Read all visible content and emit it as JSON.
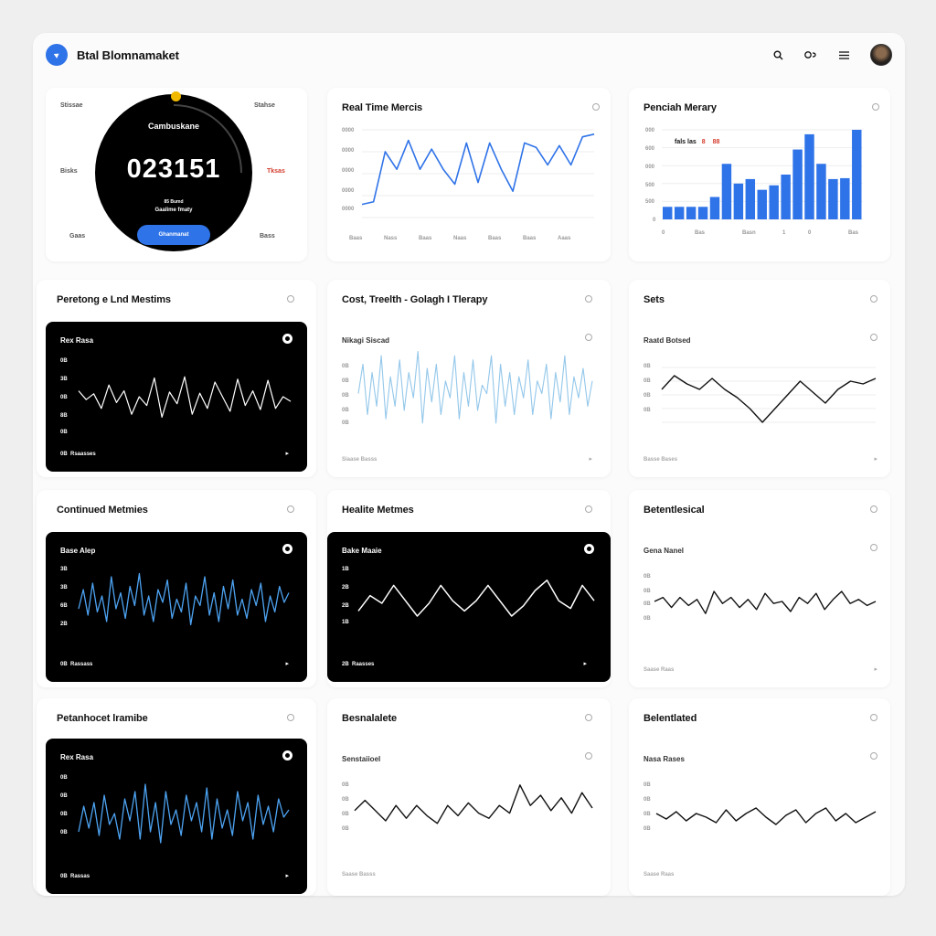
{
  "app": {
    "title": "Btal Blomnamaket"
  },
  "header": {
    "search_icon": "search-icon",
    "settings_icon": "settings-icon",
    "menu_icon": "menu-icon",
    "avatar_icon": "avatar"
  },
  "gauge": {
    "title": "Cambuskane",
    "value": "023151",
    "note1": "85 Bumd",
    "note2": "Gaalime fmaty",
    "button": "Ghanmanat",
    "labels": {
      "top_left": "Stissae",
      "top_right": "Stahse",
      "mid_left": "Bisks",
      "mid_right": "Tksas",
      "bottom_left": "Gaas",
      "bottom_right": "Bass"
    },
    "colors": {
      "ring": "#000000",
      "accent": "#f1b900",
      "button": "#2f73e8",
      "warning": "#d43b2c"
    }
  },
  "cards": {
    "realtime": {
      "title": "Real Time Mercis",
      "ylabels": [
        "0000",
        "0000",
        "0000",
        "0000",
        "0000"
      ],
      "xlabels": [
        "Baas",
        "Nass",
        "Baas",
        "Naas",
        "Baas",
        "Baas",
        "Aaas"
      ]
    },
    "penciah": {
      "title": "Penciah Merary",
      "legend": "fals las",
      "legend_red": "8",
      "legend_red2": "88",
      "ylabels": [
        "000",
        "600",
        "000",
        "500",
        "500",
        "0"
      ],
      "xlabels": [
        "0",
        "Bas",
        "Basn",
        "1",
        "0",
        "Bas"
      ]
    },
    "pertong": {
      "title": "Peretong e Lnd Mestims",
      "panel_label": "Rex Rasa",
      "ylabels": [
        "0B",
        "3B",
        "0B",
        "8B",
        "0B"
      ],
      "foot": "Rsaasses",
      "foot_num": "0B"
    },
    "cost": {
      "title": "Cost, Treelth - Golagh I Tlerapy",
      "panel_label": "Nikagi Siscad",
      "ylabels": [
        "0B",
        "0B",
        "0B",
        "0B",
        "0B"
      ],
      "foot": "Siaase Basss"
    },
    "sets": {
      "title": "Sets",
      "panel_label": "Raatd Botsed",
      "ylabels": [
        "0B",
        "0B",
        "0B",
        "0B"
      ],
      "foot": "Basse Bases"
    },
    "continued": {
      "title": "Continued Metmies",
      "panel_label": "Base Alep",
      "ylabels": [
        "3B",
        "3B",
        "6B",
        "2B"
      ],
      "foot": "Rassass",
      "foot_num": "0B"
    },
    "healite": {
      "title": "Healite Metmes",
      "panel_label": "Bake Maaie",
      "ylabels": [
        "1B",
        "2B",
        "2B",
        "1B"
      ],
      "foot": "Raasses",
      "foot_num": "2B"
    },
    "betentle": {
      "title": "Betentlesical",
      "panel_label": "Gena Nanel",
      "ylabels": [
        "0B",
        "0B",
        "0B",
        "0B"
      ],
      "foot": "Saase Raas"
    },
    "petanoncel": {
      "title": "Petanhocet lramibe",
      "panel_label": "Rex Rasa",
      "ylabels": [
        "0B",
        "0B",
        "0B",
        "0B"
      ],
      "foot": "Rassas",
      "foot_num": "0B"
    },
    "besninte": {
      "title": "Besnalalete",
      "panel_label": "Senstaiioel",
      "ylabels": [
        "0B",
        "0B",
        "0B",
        "0B"
      ],
      "foot": "Saase Basss"
    },
    "beleni": {
      "title": "Belentlated",
      "panel_label": "Nasa Rases",
      "ylabels": [
        "0B",
        "0B",
        "0B",
        "0B"
      ],
      "foot": "Saase Raas"
    }
  },
  "chart_data": [
    {
      "type": "line",
      "title": "Real Time Mercis",
      "series": [
        {
          "values": [
            0.15,
            0.18,
            0.75,
            0.55,
            0.88,
            0.55,
            0.78,
            0.55,
            0.38,
            0.85,
            0.4,
            0.85,
            0.55,
            0.3,
            0.85,
            0.8,
            0.6,
            0.82,
            0.6,
            0.92,
            0.95
          ]
        }
      ],
      "grid": true
    },
    {
      "type": "bar",
      "title": "Penciah Merary",
      "values": [
        0.14,
        0.14,
        0.14,
        0.14,
        0.25,
        0.62,
        0.4,
        0.45,
        0.33,
        0.38,
        0.5,
        0.78,
        0.95,
        0.62,
        0.45,
        0.46,
        1.0
      ],
      "grid": true
    },
    {
      "type": "line",
      "title": "Peretong e Lnd Mestims",
      "series": [
        {
          "values": [
            0.6,
            0.45,
            0.55,
            0.3,
            0.7,
            0.4,
            0.6,
            0.2,
            0.5,
            0.35,
            0.82,
            0.15,
            0.58,
            0.38,
            0.84,
            0.2,
            0.56,
            0.3,
            0.75,
            0.5,
            0.25,
            0.8,
            0.35,
            0.6,
            0.28,
            0.78,
            0.3,
            0.5,
            0.42
          ]
        }
      ]
    },
    {
      "type": "line",
      "title": "Cost, Treelth - Golagh I Tlerapy",
      "series": [
        {
          "values": [
            0.45,
            0.8,
            0.2,
            0.7,
            0.3,
            0.9,
            0.15,
            0.65,
            0.3,
            0.85,
            0.25,
            0.7,
            0.4,
            0.95,
            0.1,
            0.75,
            0.35,
            0.8,
            0.2,
            0.6,
            0.4,
            0.9,
            0.15,
            0.7,
            0.3,
            0.85,
            0.25,
            0.55,
            0.45,
            0.9,
            0.1,
            0.8,
            0.3,
            0.7,
            0.2,
            0.65,
            0.4,
            0.85,
            0.2,
            0.6,
            0.45,
            0.8,
            0.15,
            0.7,
            0.35,
            0.9,
            0.2,
            0.65,
            0.4,
            0.75,
            0.3,
            0.6
          ]
        }
      ]
    },
    {
      "type": "line",
      "title": "Sets",
      "series": [
        {
          "values": [
            0.6,
            0.85,
            0.7,
            0.6,
            0.8,
            0.6,
            0.45,
            0.25,
            0.0,
            0.25,
            0.5,
            0.75,
            0.55,
            0.35,
            0.6,
            0.75,
            0.7,
            0.8
          ]
        }
      ]
    },
    {
      "type": "line",
      "title": "Continued Metmies",
      "series": [
        {
          "values": [
            0.4,
            0.7,
            0.3,
            0.8,
            0.35,
            0.6,
            0.2,
            0.9,
            0.4,
            0.65,
            0.25,
            0.75,
            0.45,
            0.95,
            0.3,
            0.6,
            0.2,
            0.7,
            0.5,
            0.85,
            0.25,
            0.55,
            0.35,
            0.8,
            0.15,
            0.6,
            0.45,
            0.9,
            0.3,
            0.65,
            0.2,
            0.75,
            0.4,
            0.85,
            0.3,
            0.55,
            0.25,
            0.7,
            0.45,
            0.8,
            0.2,
            0.6,
            0.35,
            0.75,
            0.5,
            0.65
          ]
        }
      ]
    },
    {
      "type": "line",
      "title": "Healite Metmes",
      "series": [
        {
          "values": [
            0.35,
            0.65,
            0.5,
            0.85,
            0.55,
            0.25,
            0.5,
            0.85,
            0.55,
            0.35,
            0.55,
            0.85,
            0.55,
            0.25,
            0.45,
            0.75,
            0.95,
            0.55,
            0.4,
            0.85,
            0.55
          ]
        }
      ]
    },
    {
      "type": "line",
      "title": "Betentlesical",
      "series": [
        {
          "values": [
            0.5,
            0.6,
            0.35,
            0.6,
            0.4,
            0.55,
            0.2,
            0.75,
            0.45,
            0.6,
            0.35,
            0.55,
            0.3,
            0.7,
            0.45,
            0.5,
            0.25,
            0.6,
            0.45,
            0.7,
            0.3,
            0.55,
            0.75,
            0.45,
            0.55,
            0.4,
            0.5
          ]
        }
      ]
    },
    {
      "type": "line",
      "title": "Petanhocet lramibe",
      "series": [
        {
          "values": [
            0.3,
            0.65,
            0.35,
            0.7,
            0.25,
            0.8,
            0.4,
            0.55,
            0.2,
            0.75,
            0.45,
            0.85,
            0.2,
            0.95,
            0.3,
            0.7,
            0.15,
            0.85,
            0.4,
            0.6,
            0.25,
            0.8,
            0.45,
            0.7,
            0.3,
            0.9,
            0.2,
            0.75,
            0.35,
            0.6,
            0.25,
            0.85,
            0.45,
            0.7,
            0.2,
            0.8,
            0.4,
            0.65,
            0.3,
            0.75,
            0.5,
            0.6
          ]
        }
      ]
    },
    {
      "type": "line",
      "title": "Besnalalete",
      "series": [
        {
          "values": [
            0.45,
            0.65,
            0.45,
            0.25,
            0.55,
            0.3,
            0.55,
            0.35,
            0.2,
            0.55,
            0.35,
            0.6,
            0.4,
            0.3,
            0.55,
            0.4,
            0.95,
            0.55,
            0.75,
            0.45,
            0.7,
            0.4,
            0.8,
            0.5
          ]
        }
      ]
    },
    {
      "type": "line",
      "title": "Belentlated",
      "series": [
        {
          "values": [
            0.6,
            0.45,
            0.65,
            0.4,
            0.6,
            0.5,
            0.35,
            0.7,
            0.4,
            0.6,
            0.75,
            0.5,
            0.3,
            0.55,
            0.7,
            0.35,
            0.6,
            0.75,
            0.4,
            0.6,
            0.35,
            0.5,
            0.65
          ]
        }
      ]
    }
  ]
}
